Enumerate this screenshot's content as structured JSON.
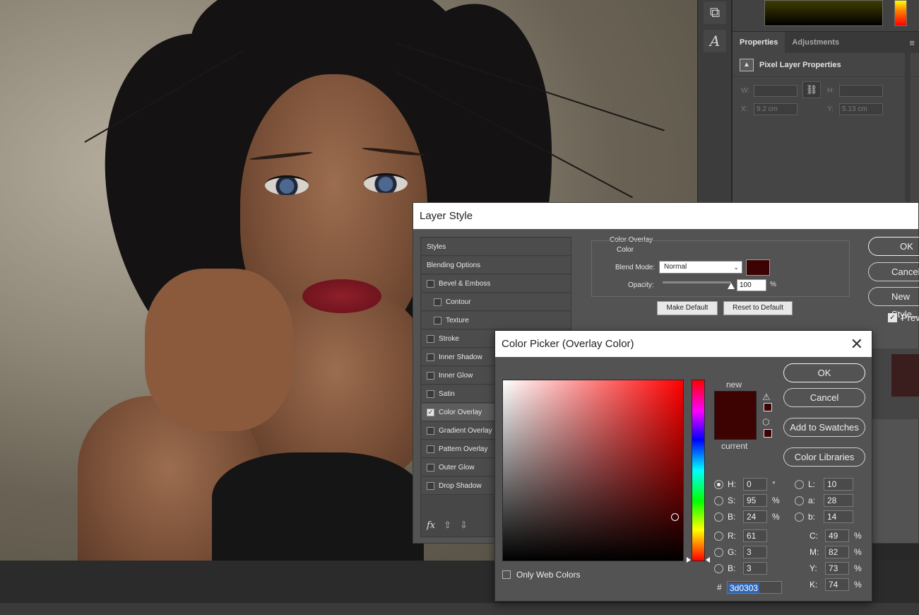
{
  "colors": {
    "overlay": "#3d0303",
    "accent_selection": "#3066b8"
  },
  "properties_panel": {
    "tabs": [
      "Properties",
      "Adjustments"
    ],
    "title": "Pixel Layer Properties",
    "w_label": "W:",
    "w_value": "",
    "h_label": "H:",
    "h_value": "",
    "x_label": "X:",
    "x_value": "9.2 cm",
    "y_label": "Y:",
    "y_value": "5.13 cm"
  },
  "layer_style": {
    "title": "Layer Style",
    "items": [
      {
        "label": "Styles",
        "checkbox": false,
        "checked": false,
        "indent": false
      },
      {
        "label": "Blending Options",
        "checkbox": false,
        "checked": false,
        "indent": false
      },
      {
        "label": "Bevel & Emboss",
        "checkbox": true,
        "checked": false,
        "indent": false
      },
      {
        "label": "Contour",
        "checkbox": true,
        "checked": false,
        "indent": true
      },
      {
        "label": "Texture",
        "checkbox": true,
        "checked": false,
        "indent": true
      },
      {
        "label": "Stroke",
        "checkbox": true,
        "checked": false,
        "indent": false
      },
      {
        "label": "Inner Shadow",
        "checkbox": true,
        "checked": false,
        "indent": false
      },
      {
        "label": "Inner Glow",
        "checkbox": true,
        "checked": false,
        "indent": false
      },
      {
        "label": "Satin",
        "checkbox": true,
        "checked": false,
        "indent": false
      },
      {
        "label": "Color Overlay",
        "checkbox": true,
        "checked": true,
        "indent": false,
        "active": true
      },
      {
        "label": "Gradient Overlay",
        "checkbox": true,
        "checked": false,
        "indent": false
      },
      {
        "label": "Pattern Overlay",
        "checkbox": true,
        "checked": false,
        "indent": false
      },
      {
        "label": "Outer Glow",
        "checkbox": true,
        "checked": false,
        "indent": false
      },
      {
        "label": "Drop Shadow",
        "checkbox": true,
        "checked": false,
        "indent": false
      }
    ],
    "fx_label": "fx",
    "section_title": "Color Overlay",
    "group_title": "Color",
    "blend_mode_label": "Blend Mode:",
    "blend_mode_value": "Normal",
    "opacity_label": "Opacity:",
    "opacity_value": "100",
    "opacity_unit": "%",
    "opacity_fraction": 1.0,
    "make_default": "Make Default",
    "reset_default": "Reset to Default",
    "ok": "OK",
    "cancel": "Cancel",
    "new_style": "New Style...",
    "preview": "Preview"
  },
  "color_picker": {
    "title": "Color Picker (Overlay Color)",
    "new_label": "new",
    "current_label": "current",
    "ok": "OK",
    "cancel": "Cancel",
    "add_swatches": "Add to Swatches",
    "color_libraries": "Color Libraries",
    "hsb": [
      {
        "label": "H:",
        "value": "0",
        "unit": "°",
        "selected": true
      },
      {
        "label": "S:",
        "value": "95",
        "unit": "%",
        "selected": false
      },
      {
        "label": "B:",
        "value": "24",
        "unit": "%",
        "selected": false
      }
    ],
    "rgb": [
      {
        "label": "R:",
        "value": "61"
      },
      {
        "label": "G:",
        "value": "3"
      },
      {
        "label": "B:",
        "value": "3"
      }
    ],
    "lab": [
      {
        "label": "L:",
        "value": "10"
      },
      {
        "label": "a:",
        "value": "28"
      },
      {
        "label": "b:",
        "value": "14"
      }
    ],
    "cmyk": [
      {
        "label": "C:",
        "value": "49",
        "unit": "%"
      },
      {
        "label": "M:",
        "value": "82",
        "unit": "%"
      },
      {
        "label": "Y:",
        "value": "73",
        "unit": "%"
      },
      {
        "label": "K:",
        "value": "74",
        "unit": "%"
      }
    ],
    "hex_label": "#",
    "hex_value": "3d0303",
    "only_web_colors": "Only Web Colors"
  }
}
